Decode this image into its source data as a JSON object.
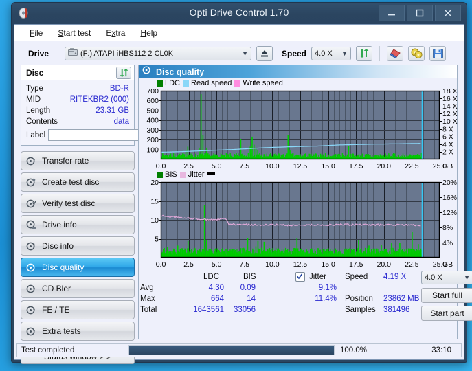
{
  "window": {
    "title": "Opti Drive Control 1.70",
    "app_icon": "disc-icon",
    "minimize": "–",
    "maximize": "☐",
    "close": "✕"
  },
  "menu": [
    {
      "label": "File",
      "accel": "F"
    },
    {
      "label": "Start test",
      "accel": "S"
    },
    {
      "label": "Extra",
      "accel": "x"
    },
    {
      "label": "Help",
      "accel": "H"
    }
  ],
  "toolbar": {
    "drive_label": "Drive",
    "drive_value": "(F:)   ATAPI iHBS112  2 CL0K",
    "eject_icon": "eject-icon",
    "speed_label": "Speed",
    "speed_value": "4.0 X",
    "refresh_icon": "refresh-icon",
    "erase_icon": "eraser-icon",
    "discs_icon": "two-discs-icon",
    "save_icon": "save-icon"
  },
  "disc": {
    "header": "Disc",
    "refresh_icon": "refresh-icon",
    "rows": [
      {
        "key": "Type",
        "value": "BD-R"
      },
      {
        "key": "MID",
        "value": "RITEKBR2 (000)"
      },
      {
        "key": "Length",
        "value": "23.31 GB"
      },
      {
        "key": "Contents",
        "value": "data"
      }
    ],
    "label_key": "Label",
    "label_value": "",
    "label_placeholder": "",
    "label_icon": "disc-icon"
  },
  "nav": {
    "items": [
      {
        "label": "Transfer rate",
        "icon": "disc-transfer-icon",
        "selected": false
      },
      {
        "label": "Create test disc",
        "icon": "disc-create-icon",
        "selected": false
      },
      {
        "label": "Verify test disc",
        "icon": "disc-verify-icon",
        "selected": false
      },
      {
        "label": "Drive info",
        "icon": "disc-drive-icon",
        "selected": false
      },
      {
        "label": "Disc info",
        "icon": "disc-info-icon",
        "selected": false
      },
      {
        "label": "Disc quality",
        "icon": "disc-quality-icon",
        "selected": true
      },
      {
        "label": "CD Bler",
        "icon": "disc-bler-icon",
        "selected": false
      },
      {
        "label": "FE / TE",
        "icon": "disc-fete-icon",
        "selected": false
      },
      {
        "label": "Extra tests",
        "icon": "disc-extra-icon",
        "selected": false
      }
    ],
    "status_button": "Status window > >"
  },
  "content": {
    "header": "Disc quality",
    "header_icon": "disc-quality-icon"
  },
  "chart_data": [
    {
      "type": "line",
      "id": "ldc-chart",
      "title": "",
      "xlabel": "GB",
      "ylabel": "",
      "xlim": [
        0,
        25
      ],
      "ylim": [
        0,
        700
      ],
      "y2lim": [
        0,
        18
      ],
      "xticks": [
        0.0,
        2.5,
        5.0,
        7.5,
        10.0,
        12.5,
        15.0,
        17.5,
        20.0,
        22.5,
        25.0
      ],
      "xticklabels": [
        "0.0",
        "2.5",
        "5.0",
        "7.5",
        "10.0",
        "12.5",
        "15.0",
        "17.5",
        "20.0",
        "22.5",
        "25.0"
      ],
      "yticks": [
        100,
        200,
        300,
        400,
        500,
        600,
        700
      ],
      "yticklabels": [
        "100",
        "200",
        "300",
        "400",
        "500",
        "600",
        "700"
      ],
      "y2ticks": [
        2,
        4,
        6,
        8,
        10,
        12,
        14,
        16,
        18
      ],
      "y2ticklabels": [
        "2 X",
        "4 X",
        "6 X",
        "8 X",
        "10 X",
        "12 X",
        "14 X",
        "16 X",
        "18 X"
      ],
      "grid": true,
      "legend": [
        {
          "name": "LDC",
          "color": "#00a000"
        },
        {
          "name": "Read speed",
          "color": "#8ad7f8"
        },
        {
          "name": "Write speed",
          "color": "#ff8ce0"
        }
      ],
      "series": [
        {
          "name": "LDC",
          "color": "#00c000",
          "kind": "bar",
          "peak": 664,
          "values": [
            35,
            22,
            48,
            30,
            25,
            60,
            28,
            33,
            26,
            40,
            29,
            22,
            34,
            95,
            130,
            45,
            30,
            26,
            38,
            24,
            120,
            664,
            250,
            66,
            120,
            44,
            30,
            26,
            34,
            22,
            28,
            26,
            30,
            24,
            26,
            30,
            22,
            28,
            26,
            30,
            24,
            26,
            205,
            60,
            44,
            38,
            70,
            130,
            232,
            150,
            120,
            95,
            70,
            44,
            30,
            26,
            34,
            22,
            28,
            26,
            30,
            40,
            60,
            28,
            34,
            26,
            30,
            250,
            90,
            55,
            30,
            26,
            34,
            22,
            28,
            26,
            30,
            24,
            26,
            30,
            22,
            28,
            26,
            30,
            24,
            26,
            30,
            22,
            28,
            26,
            30,
            34,
            55,
            40,
            26,
            30,
            22,
            28,
            26,
            140,
            30,
            26,
            34,
            22,
            28,
            26,
            30,
            24,
            26,
            30,
            22,
            28,
            26,
            30,
            24,
            26,
            30,
            22,
            28,
            26,
            30,
            24,
            26,
            30,
            22,
            28,
            26,
            30,
            24,
            26,
            30,
            22,
            28,
            26,
            30,
            24,
            26,
            30,
            22
          ]
        },
        {
          "name": "Read speed",
          "color": "#8ad7f8",
          "kind": "line",
          "start_x": 0.0,
          "end_x": 23.4,
          "values_x_speed": [
            [
              0.0,
              1.9
            ],
            [
              1.5,
              2.0
            ],
            [
              3.2,
              2.2
            ],
            [
              6.5,
              2.6
            ],
            [
              9.5,
              3.1
            ],
            [
              11.5,
              3.3
            ],
            [
              14.0,
              3.5
            ],
            [
              16.0,
              3.8
            ],
            [
              19.0,
              4.0
            ],
            [
              21.5,
              4.1
            ],
            [
              23.3,
              4.2
            ]
          ]
        }
      ],
      "cursor_x": 23.4,
      "cursor_color": "#35c8f5"
    },
    {
      "type": "line",
      "id": "bis-jitter-chart",
      "title": "",
      "xlabel": "GB",
      "ylabel": "",
      "xlim": [
        0,
        25
      ],
      "ylim": [
        0,
        20
      ],
      "y2lim": [
        0,
        20
      ],
      "xticks": [
        0.0,
        2.5,
        5.0,
        7.5,
        10.0,
        12.5,
        15.0,
        17.5,
        20.0,
        22.5,
        25.0
      ],
      "xticklabels": [
        "0.0",
        "2.5",
        "5.0",
        "7.5",
        "10.0",
        "12.5",
        "15.0",
        "17.5",
        "20.0",
        "22.5",
        "25.0"
      ],
      "yticks": [
        5,
        10,
        15,
        20
      ],
      "yticklabels": [
        "5",
        "10",
        "15",
        "20"
      ],
      "y2ticks": [
        4,
        8,
        12,
        16,
        20
      ],
      "y2ticklabels": [
        "4%",
        "8%",
        "12%",
        "16%",
        "20%"
      ],
      "grid": true,
      "legend": [
        {
          "name": "BIS",
          "color": "#00a000"
        },
        {
          "name": "Jitter",
          "color": "#e8b8e0"
        },
        {
          "name": "",
          "color": "#000000"
        }
      ],
      "series": [
        {
          "name": "BIS",
          "color": "#00c000",
          "kind": "bar",
          "peak": 14,
          "values": [
            1.5,
            2.2,
            1.2,
            2.8,
            1.6,
            1.2,
            2.4,
            1.4,
            3.2,
            1.5,
            1.2,
            2.0,
            1.4,
            4.4,
            2.0,
            1.3,
            2.6,
            1.2,
            1.8,
            1.4,
            2.2,
            14.0,
            4.6,
            1.6,
            2.2,
            1.3,
            1.8,
            1.2,
            2.0,
            1.4,
            1.6,
            1.2,
            2.4,
            1.3,
            1.8,
            1.2,
            2.0,
            1.4,
            1.6,
            1.2,
            2.6,
            1.3,
            5.1,
            1.8,
            1.2,
            2.0,
            3.0,
            4.4,
            2.2,
            1.4,
            4.2,
            1.6,
            1.2,
            2.0,
            1.4,
            1.6,
            1.2,
            2.4,
            1.3,
            1.8,
            1.2,
            2.0,
            1.4,
            1.6,
            1.2,
            2.2,
            5.2,
            1.6,
            1.2,
            2.0,
            1.4,
            1.6,
            1.2,
            2.4,
            1.3,
            1.8,
            1.2,
            2.0,
            1.4,
            1.6,
            1.2,
            2.2,
            1.3,
            1.8,
            1.2,
            2.0,
            1.4,
            1.6,
            1.2,
            2.4,
            1.3,
            1.8,
            1.2,
            2.0,
            1.4,
            1.6,
            4.6,
            2.2,
            1.3,
            1.8,
            1.2,
            3.2,
            1.4,
            1.6,
            1.2,
            2.4,
            1.3,
            3.4,
            1.2,
            2.0,
            1.4,
            1.6,
            3.8,
            2.2,
            1.3,
            1.8,
            4.0,
            2.0,
            1.4,
            1.6,
            1.2,
            2.4,
            6.8,
            1.8,
            1.2,
            3.6,
            1.4,
            1.6
          ]
        },
        {
          "name": "Jitter",
          "color": "#e0a8d8",
          "kind": "line",
          "values_x_jitter": [
            [
              0.0,
              11.1
            ],
            [
              1.0,
              10.8
            ],
            [
              2.0,
              10.5
            ],
            [
              3.0,
              10.3
            ],
            [
              4.0,
              10.1
            ],
            [
              5.0,
              10.1
            ],
            [
              5.9,
              10.3
            ],
            [
              6.05,
              8.8
            ],
            [
              8.0,
              8.7
            ],
            [
              12.0,
              8.6
            ],
            [
              16.0,
              8.7
            ],
            [
              20.0,
              8.7
            ],
            [
              23.3,
              8.6
            ]
          ]
        }
      ],
      "cursor_x": 23.4,
      "cursor_color": "#35c8f5"
    }
  ],
  "stats": {
    "col_headers": [
      "LDC",
      "BIS"
    ],
    "jitter_label": "Jitter",
    "jitter_checked": true,
    "rows": [
      {
        "name": "Avg",
        "ldc": "4.30",
        "bis": "0.09",
        "jitter": "9.1%"
      },
      {
        "name": "Max",
        "ldc": "664",
        "bis": "14",
        "jitter": "11.4%"
      },
      {
        "name": "Total",
        "ldc": "1643561",
        "bis": "33056",
        "jitter": ""
      }
    ],
    "speed_label": "Speed",
    "speed_value": "4.19 X",
    "position_label": "Position",
    "position_value": "23862 MB",
    "samples_label": "Samples",
    "samples_value": "381496",
    "speed_select": "4.0 X",
    "start_full": "Start full",
    "start_part": "Start part"
  },
  "statusbar": {
    "text": "Test completed",
    "percent": "100.0%",
    "progress": 100,
    "time": "33:10"
  },
  "colors": {
    "accent": "#2ea6e8",
    "plot_bg": "#69778f",
    "ldc_green": "#00c000",
    "read_speed": "#8ad7f8",
    "write_speed": "#ff8ce0",
    "jitter": "#e0a8d8",
    "value_blue": "#2a2ad0"
  }
}
